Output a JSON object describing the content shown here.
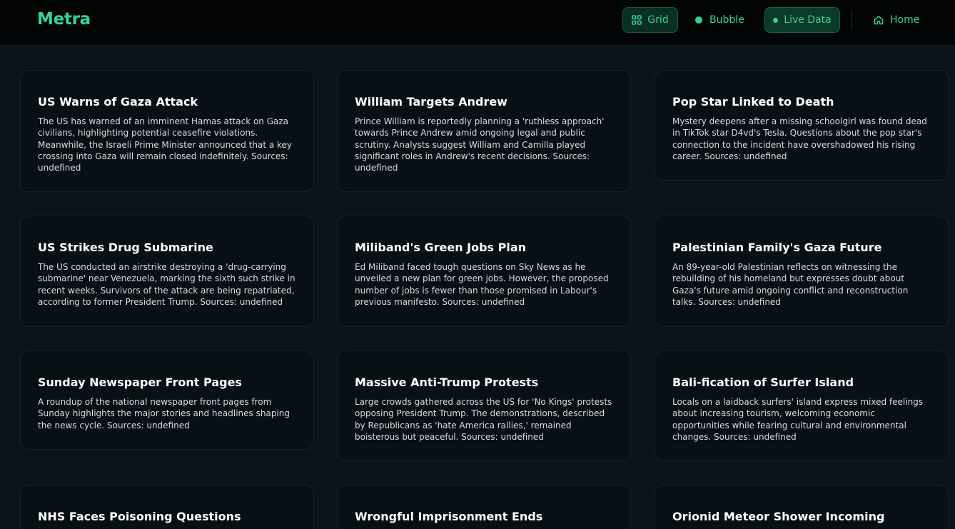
{
  "header": {
    "logo": "Metra",
    "nav": {
      "grid": "Grid",
      "bubble": "Bubble",
      "live_data": "Live Data",
      "home": "Home"
    }
  },
  "colors": {
    "accent": "#34d399",
    "background": "#0b1419",
    "card": "#071014"
  },
  "cards": [
    {
      "title": "US Warns of Gaza Attack",
      "body": "The US has warned of an imminent Hamas attack on Gaza civilians, highlighting potential ceasefire violations. Meanwhile, the Israeli Prime Minister announced that a key crossing into Gaza will remain closed indefinitely. Sources: undefined"
    },
    {
      "title": "William Targets Andrew",
      "body": "Prince William is reportedly planning a 'ruthless approach' towards Prince Andrew amid ongoing legal and public scrutiny. Analysts suggest William and Camilla played significant roles in Andrew's recent decisions. Sources: undefined"
    },
    {
      "title": "Pop Star Linked to Death",
      "body": "Mystery deepens after a missing schoolgirl was found dead in TikTok star D4vd's Tesla. Questions about the pop star's connection to the incident have overshadowed his rising career. Sources: undefined"
    },
    {
      "title": "US Strikes Drug Submarine",
      "body": "The US conducted an airstrike destroying a 'drug-carrying submarine' near Venezuela, marking the sixth such strike in recent weeks. Survivors of the attack are being repatriated, according to former President Trump. Sources: undefined"
    },
    {
      "title": "Miliband's Green Jobs Plan",
      "body": "Ed Miliband faced tough questions on Sky News as he unveiled a new plan for green jobs. However, the proposed number of jobs is fewer than those promised in Labour's previous manifesto. Sources: undefined"
    },
    {
      "title": "Palestinian Family's Gaza Future",
      "body": "An 89-year-old Palestinian reflects on witnessing the rebuilding of his homeland but expresses doubt about Gaza's future amid ongoing conflict and reconstruction talks. Sources: undefined"
    },
    {
      "title": "Sunday Newspaper Front Pages",
      "body": "A roundup of the national newspaper front pages from Sunday highlights the major stories and headlines shaping the news cycle. Sources: undefined"
    },
    {
      "title": "Massive Anti-Trump Protests",
      "body": "Large crowds gathered across the US for 'No Kings' protests opposing President Trump. The demonstrations, described by Republicans as 'hate America rallies,' remained boisterous but peaceful. Sources: undefined"
    },
    {
      "title": "Bali-fication of Surfer Island",
      "body": "Locals on a laidback surfers' island express mixed feelings about increasing tourism, welcoming economic opportunities while fearing cultural and environmental changes. Sources: undefined"
    },
    {
      "title": "NHS Faces Poisoning Questions",
      "body": ""
    },
    {
      "title": "Wrongful Imprisonment Ends",
      "body": ""
    },
    {
      "title": "Orionid Meteor Shower Incoming",
      "body": ""
    }
  ]
}
